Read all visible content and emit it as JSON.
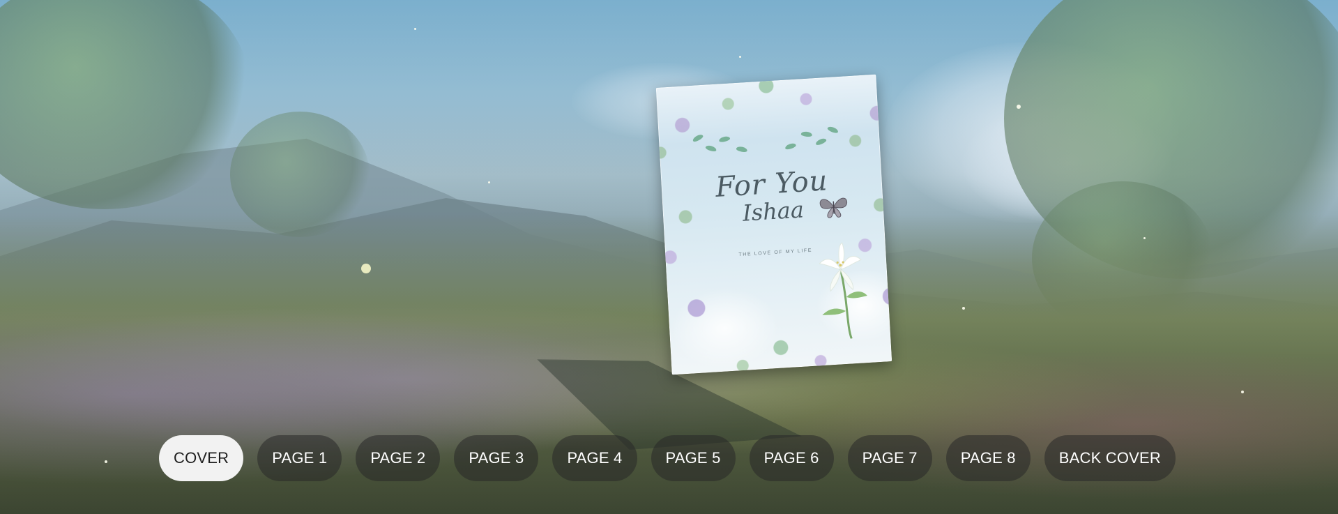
{
  "book": {
    "cover_title": "For You",
    "cover_name": "Ishaa",
    "cover_subtitle": "THE LOVE OF MY LIFE"
  },
  "nav": {
    "items": [
      {
        "label": "COVER",
        "active": true
      },
      {
        "label": "PAGE 1",
        "active": false
      },
      {
        "label": "PAGE 2",
        "active": false
      },
      {
        "label": "PAGE 3",
        "active": false
      },
      {
        "label": "PAGE 4",
        "active": false
      },
      {
        "label": "PAGE 5",
        "active": false
      },
      {
        "label": "PAGE 6",
        "active": false
      },
      {
        "label": "PAGE 7",
        "active": false
      },
      {
        "label": "PAGE 8",
        "active": false
      },
      {
        "label": "BACK COVER",
        "active": false
      }
    ]
  },
  "colors": {
    "active_pill": "#f2f2f2",
    "inactive_pill": "rgba(40,40,40,0.55)",
    "pill_text": "#ffffff"
  }
}
